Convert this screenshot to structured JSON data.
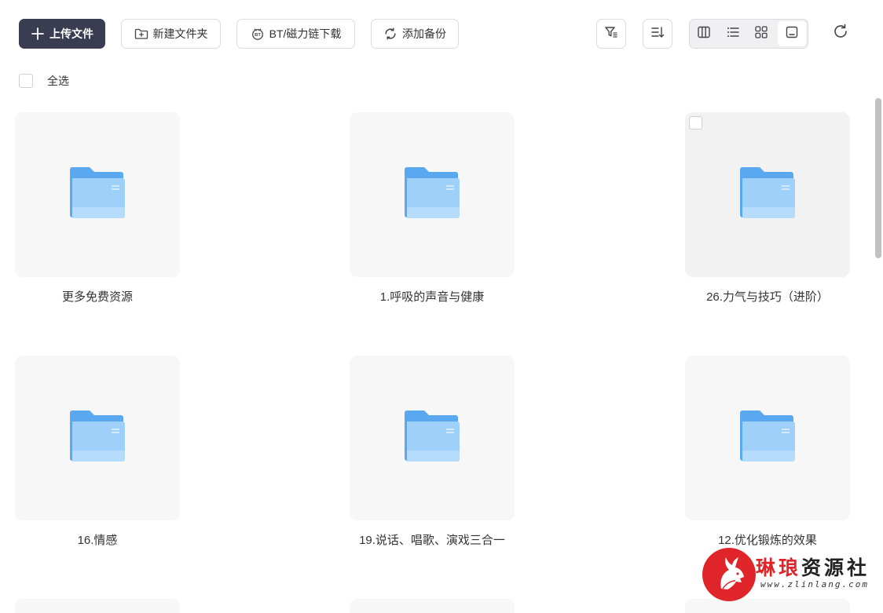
{
  "toolbar": {
    "upload_label": "上传文件",
    "new_folder_label": "新建文件夹",
    "bt_download_label": "BT/磁力链下载",
    "add_backup_label": "添加备份"
  },
  "select_all_label": "全选",
  "folders": [
    {
      "name": "更多免费资源"
    },
    {
      "name": "1.呼吸的声音与健康"
    },
    {
      "name": "26.力气与技巧（进阶）"
    },
    {
      "name": "16.情感"
    },
    {
      "name": "19.说话、唱歌、演戏三合一"
    },
    {
      "name": "12.优化锻炼的效果"
    }
  ],
  "watermark": {
    "brand_prefix": "琳琅",
    "brand_suffix": "资源社",
    "url": "www.zlinlang.com"
  },
  "colors": {
    "primary_button": "#3a3d52",
    "folder_blue": "#5aa9f0",
    "thumb_bg": "#f7f7f7",
    "watermark_red": "#e0252a"
  },
  "icons": {
    "upload": "plus-icon",
    "new_folder": "folder-plus-icon",
    "bt": "bt-icon",
    "backup": "sync-icon",
    "filter": "filter-icon",
    "sort": "sort-icon",
    "views": [
      "column-view-icon",
      "list-view-icon",
      "grid-view-icon",
      "large-thumb-view-icon"
    ],
    "refresh": "refresh-icon"
  }
}
